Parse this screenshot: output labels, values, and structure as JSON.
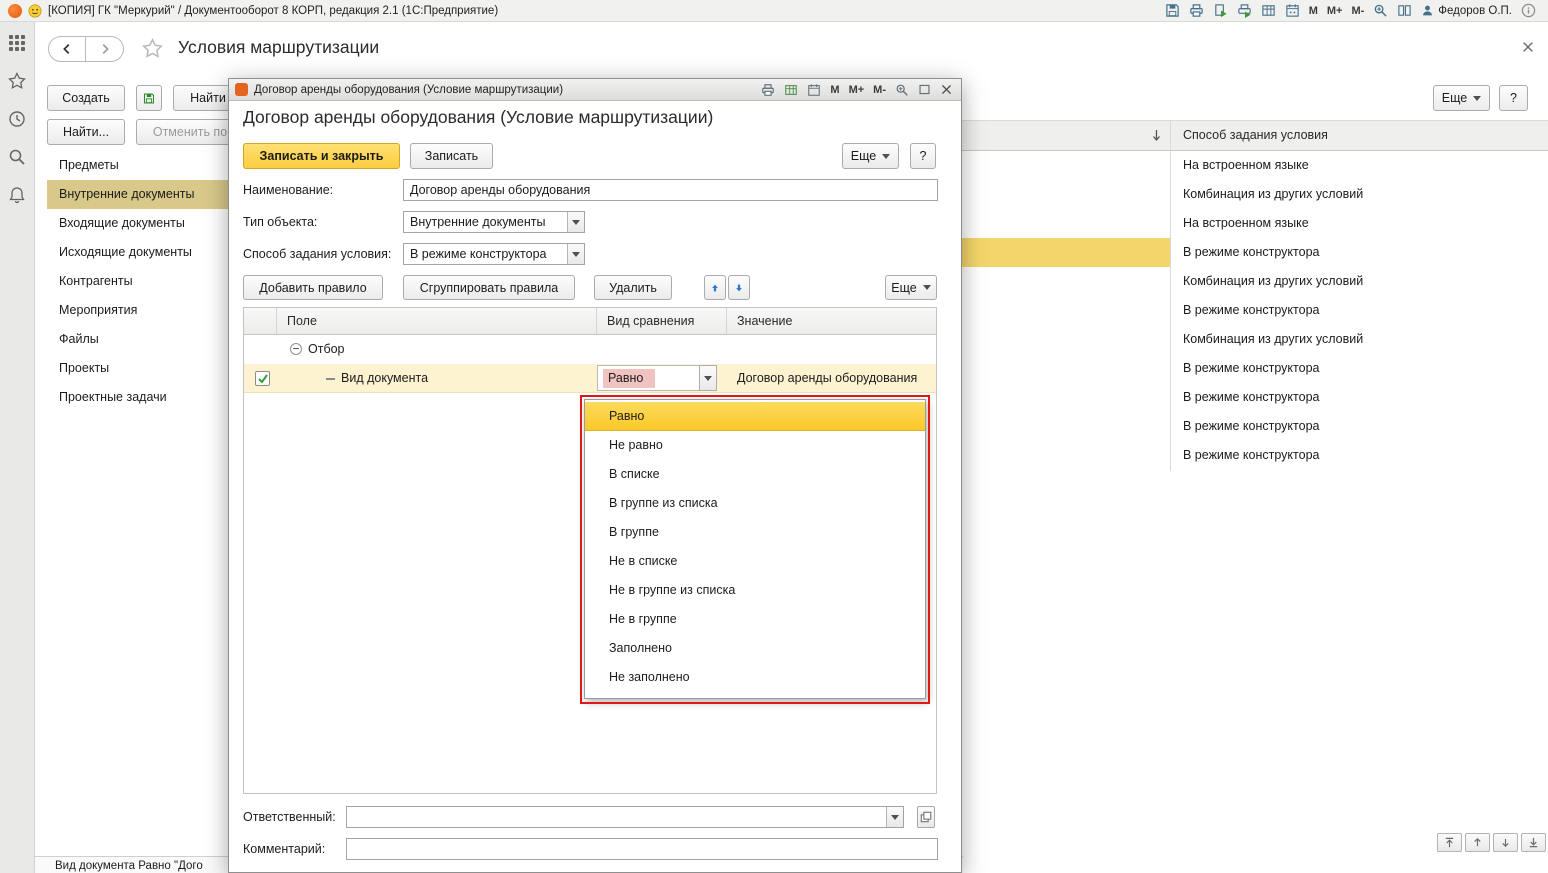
{
  "colors": {
    "primary_yellow": "#fbcd3f",
    "row_selection_gold": "#f3d569",
    "nav_selection_tan": "#d8c98a",
    "dropdown_selection": "#fbcf3d",
    "grid_row_highlight": "#fdf3d1",
    "edited_cell_pink": "#f1c3c0",
    "annotation_red": "#e01717"
  },
  "app": {
    "title": "[КОПИЯ] ГК \"Меркурий\" / Документооборот 8 КОРП, редакция 2.1  (1С:Предприятие)",
    "user_name": "Федоров О.П.",
    "memory_m": "М",
    "memory_m_plus": "М+",
    "memory_m_minus": "М-"
  },
  "window": {
    "title": "Условия маршрутизации",
    "create_button": "Создать",
    "find_top_button": "Найти",
    "more_button": "Еще",
    "help_button": "?",
    "find_button": "Найти...",
    "cancel_search_button": "Отменить по",
    "nav_items": [
      "Предметы",
      "Внутренние документы",
      "Входящие документы",
      "Исходящие документы",
      "Контрагенты",
      "Мероприятия",
      "Файлы",
      "Проекты",
      "Проектные задачи"
    ],
    "column_header": "Способ задания условия",
    "rows": [
      "На встроенном языке",
      "Комбинация из других условий",
      "На встроенном языке",
      "В режиме конструктора",
      "Комбинация из других условий",
      "В режиме конструктора",
      "Комбинация из других условий",
      "В режиме конструктора",
      "В режиме конструктора",
      "В режиме конструктора",
      "В режиме конструктора"
    ],
    "status_text": "Вид документа Равно \"Дого"
  },
  "dialog": {
    "window_title": "Договор аренды оборудования (Условие маршрутизации)",
    "memory_m": "М",
    "memory_m_plus": "М+",
    "memory_m_minus": "М-",
    "heading": "Договор аренды оборудования (Условие маршрутизации)",
    "save_close_button": "Записать и закрыть",
    "save_button": "Записать",
    "more_button": "Еще",
    "help_button": "?",
    "name_label": "Наименование:",
    "name_value": "Договор аренды оборудования",
    "object_type_label": "Тип объекта:",
    "object_type_value": "Внутренние документы",
    "method_label": "Способ задания условия:",
    "method_value": "В режиме конструктора",
    "add_rule_button": "Добавить правило",
    "group_rules_button": "Сгруппировать правила",
    "delete_button": "Удалить",
    "rules_more_button": "Еще",
    "col_field": "Поле",
    "col_comparison": "Вид сравнения",
    "col_value": "Значение",
    "group_label": "Отбор",
    "rule_field": "Вид документа",
    "rule_comparison": "Равно",
    "rule_value": "Договор аренды оборудования",
    "dropdown_items": [
      "Равно",
      "Не равно",
      "В списке",
      "В группе из списка",
      "В группе",
      "Не в списке",
      "Не в группе из списка",
      "Не в группе",
      "Заполнено",
      "Не заполнено"
    ],
    "responsible_label": "Ответственный:",
    "comment_label": "Комментарий:"
  }
}
